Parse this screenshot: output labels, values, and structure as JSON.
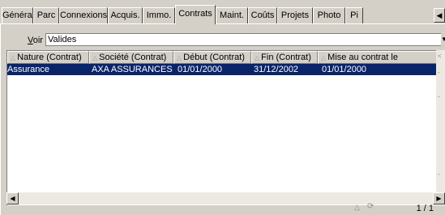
{
  "tabs": [
    {
      "label": "Général"
    },
    {
      "label": "Parc"
    },
    {
      "label": "Connexions"
    },
    {
      "label": "Acquis."
    },
    {
      "label": "Immo."
    },
    {
      "label": "Contrats"
    },
    {
      "label": "Maint."
    },
    {
      "label": "Coûts"
    },
    {
      "label": "Projets"
    },
    {
      "label": "Photo"
    },
    {
      "label": "Pi"
    }
  ],
  "active_tab": "Contrats",
  "filter": {
    "label_mnemonic": "V",
    "label_rest": "oir :",
    "value": "Valides"
  },
  "table": {
    "columns": [
      {
        "label": "Nature (Contrat)"
      },
      {
        "label": "Société (Contrat)"
      },
      {
        "label": "Début (Contrat)"
      },
      {
        "label": "Fin (Contrat)"
      },
      {
        "label": "Mise au contrat le"
      }
    ],
    "rows": [
      {
        "cells": [
          "Assurance",
          "AXA ASSURANCES",
          "01/01/2000",
          "31/12/2002",
          "01/01/2000"
        ],
        "selected": true
      }
    ]
  },
  "status": {
    "record_count": "1 / 1"
  },
  "colors": {
    "selection": "#0a246a",
    "window_bg": "#d4d0c8"
  }
}
